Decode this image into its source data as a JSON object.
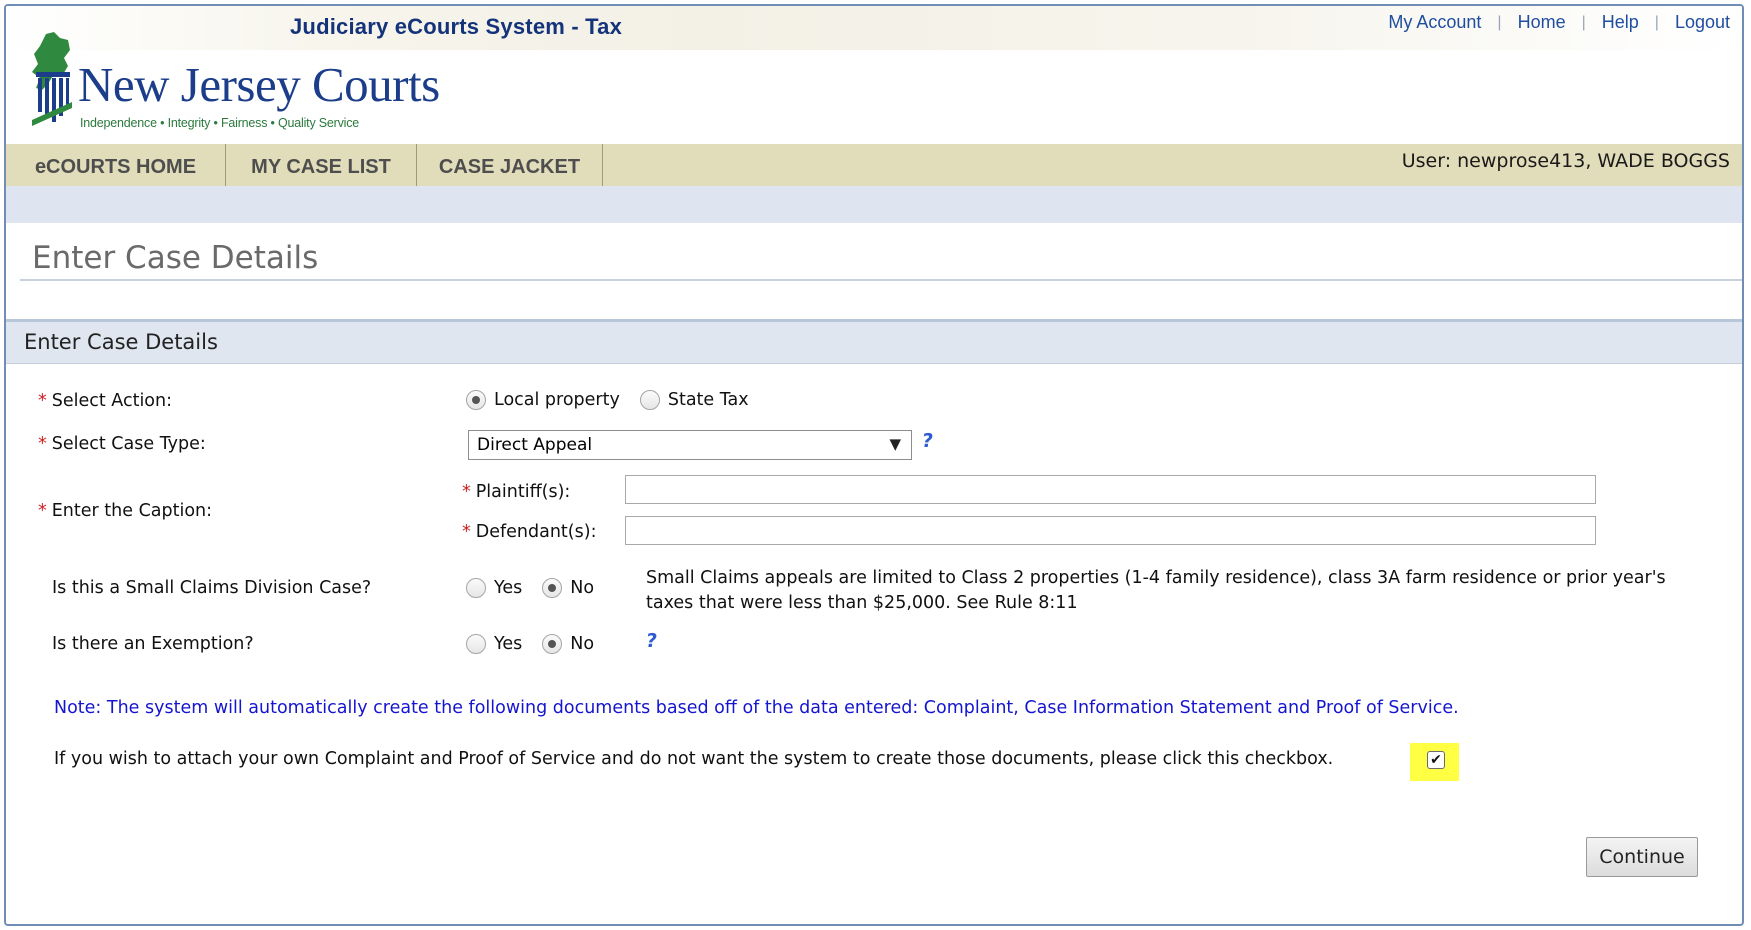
{
  "header": {
    "system_title": "Judiciary eCourts System - Tax",
    "top_links": [
      "My Account",
      "Home",
      "Help",
      "Logout"
    ],
    "logo_text": "New Jersey Courts",
    "logo_tagline": "Independence • Integrity • Fairness • Quality Service",
    "logo_icon": "nj-state-emblem-icon"
  },
  "nav": {
    "tabs": [
      "eCOURTS HOME",
      "MY CASE LIST",
      "CASE JACKET"
    ],
    "user_info": "User: newprose413, WADE BOGGS"
  },
  "page": {
    "title": "Enter Case Details",
    "panel_title": "Enter Case Details"
  },
  "form": {
    "required_marker": "*",
    "select_action": {
      "label": "Select Action:",
      "options": [
        "Local property",
        "State Tax"
      ],
      "selected": "Local property"
    },
    "case_type": {
      "label": "Select Case Type:",
      "value": "Direct Appeal",
      "arrow": "▼",
      "help": "?"
    },
    "caption": {
      "label": "Enter the Caption:",
      "plaintiff_label": "Plaintiff(s):",
      "plaintiff_value": "",
      "defendant_label": "Defendant(s):",
      "defendant_value": ""
    },
    "small_claims": {
      "label": "Is this a Small Claims Division Case?",
      "options": [
        "Yes",
        "No"
      ],
      "selected": "No",
      "note": "Small Claims appeals are limited to Class 2 properties (1-4 family residence), class 3A farm residence or prior year's taxes that were less than $25,000. See Rule 8:11"
    },
    "exemption": {
      "label": "Is there an Exemption?",
      "options": [
        "Yes",
        "No"
      ],
      "selected": "No",
      "help": "?"
    },
    "auto_note": "Note: The system will automatically create the following documents based off of the data entered: Complaint, Case Information Statement and Proof of Service.",
    "attach_text": "If you wish to attach your own Complaint and Proof of Service and do not want the system to create those documents, please click this checkbox.",
    "attach_checked": true,
    "checkmark": "✔",
    "continue_label": "Continue"
  },
  "colors": {
    "brand_blue": "#1b3d8a",
    "nav_bg": "#e1dcb9",
    "panel_bg": "#dfe6f0",
    "note_blue": "#1515d0",
    "required_red": "#d02020",
    "highlight": "#ffff44"
  }
}
